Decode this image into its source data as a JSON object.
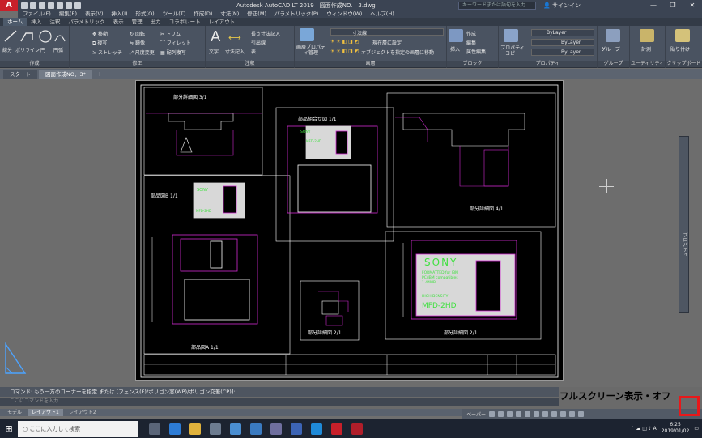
{
  "window": {
    "title": "Autodesk AutoCAD LT 2019　図面作成NO.　3.dwg",
    "search_placeholder": "キーワードまたは語句を入力",
    "signin": "サインイン",
    "controls": [
      "—",
      "❐",
      "✕"
    ]
  },
  "menu": [
    "ファイル(F)",
    "編集(E)",
    "表示(V)",
    "挿入(I)",
    "形式(O)",
    "ツール(T)",
    "作成(D)",
    "寸法(N)",
    "修正(M)",
    "パラメトリック(P)",
    "ウィンドウ(W)",
    "ヘルプ(H)"
  ],
  "ribbon_tabs": [
    "ホーム",
    "挿入",
    "注釈",
    "パラメトリック",
    "表示",
    "管理",
    "出力",
    "コラボレート",
    "レイアウト"
  ],
  "ribbon_active_tab": "ホーム",
  "ribbon": {
    "draw": {
      "label": "作成",
      "tools": [
        "線分",
        "ポリライン",
        "円",
        "円弧"
      ]
    },
    "modify": {
      "label": "修正",
      "tools": [
        "移動",
        "回転",
        "トリム",
        "複写",
        "鏡像",
        "フィレット",
        "ストレッチ",
        "尺度変更",
        "配列複写"
      ]
    },
    "annotation": {
      "label": "注釈",
      "tools": [
        "文字",
        "寸法記入",
        "長さ寸法記入",
        "引出線",
        "表"
      ]
    },
    "layers": {
      "label": "画層",
      "tools": [
        "画層プロパティ管理",
        "寸法線",
        "現在層に設定",
        "オブジェクトを指定の画層に移動"
      ]
    },
    "block": {
      "label": "ブロック",
      "tools": [
        "挿入",
        "作成",
        "編集",
        "属性編集"
      ]
    },
    "properties": {
      "label": "プロパティ",
      "tools": [
        "プロパティコピー",
        "ByLayer",
        "ByLayer",
        "ByLayer"
      ]
    },
    "groups": {
      "label": "グループ",
      "tools": [
        "グループ"
      ]
    },
    "utilities": {
      "label": "ユーティリティ",
      "tools": [
        "計測"
      ]
    },
    "clipboard": {
      "label": "クリップボード",
      "tools": [
        "貼り付け"
      ]
    }
  },
  "doc_tabs": [
    "スタート",
    "図面作成NO．3*"
  ],
  "drawing": {
    "views": [
      "部分詳細図 3/1",
      "部品組合せ図 1/1",
      "部分詳細図 4/1",
      "部品図B 1/1",
      "部品図A 1/1",
      "部分詳細図 2/1",
      "部分詳細図 2/1"
    ],
    "disk_label": {
      "brand": "SONY",
      "line1": "FORMATTED for IBM",
      "line2": "PC/IBM compatibles",
      "line3": "1.44MB",
      "density": "HIGH DENSITY",
      "model": "MFD-2HD"
    }
  },
  "command": {
    "history": "コマンド: もう一方のコーナーを指定 または [フェンス(F)/ポリゴン窓(WP)/ポリゴン交差(CP)]:",
    "placeholder": "ここにコマンドを入力"
  },
  "layout_tabs": [
    "モデル",
    "レイアウト1",
    "レイアウト2"
  ],
  "layout_active": "レイアウト1",
  "status": {
    "paper": "ペーパー"
  },
  "annotation_callout": "フルスクリーン表示・オフ",
  "taskbar": {
    "search_placeholder": "ここに入力して検索",
    "time": "6:25",
    "date": "2019/01/02"
  },
  "colors": {
    "accent_red": "#e8181a",
    "cad_magenta": "#d12bd1",
    "cad_green": "#41e041",
    "cad_white": "#ffffff"
  }
}
